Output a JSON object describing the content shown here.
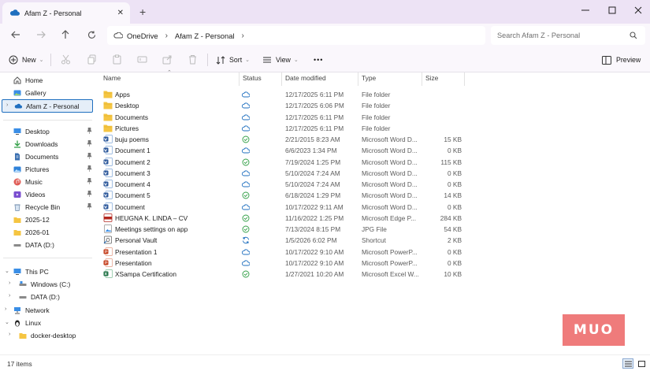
{
  "window": {
    "tab_title": "Afam Z - Personal",
    "new_tab": "+",
    "close_tab": "✕"
  },
  "address": {
    "crumbs": [
      "OneDrive",
      "Afam Z - Personal"
    ],
    "search_placeholder": "Search Afam Z - Personal"
  },
  "toolbar": {
    "new_label": "New",
    "sort_label": "Sort",
    "view_label": "View",
    "more_label": "•••",
    "preview_label": "Preview"
  },
  "sidebar": {
    "top": [
      {
        "label": "Home",
        "icon": "home-icon"
      },
      {
        "label": "Gallery",
        "icon": "gallery-icon"
      },
      {
        "label": "Afam Z - Personal",
        "icon": "onedrive-icon"
      }
    ],
    "quick": [
      {
        "label": "Desktop",
        "icon": "desktop-icon"
      },
      {
        "label": "Downloads",
        "icon": "downloads-icon"
      },
      {
        "label": "Documents",
        "icon": "documents-icon"
      },
      {
        "label": "Pictures",
        "icon": "pictures-icon"
      },
      {
        "label": "Music",
        "icon": "music-icon"
      },
      {
        "label": "Videos",
        "icon": "videos-icon"
      },
      {
        "label": "Recycle Bin",
        "icon": "recycle-bin-icon"
      },
      {
        "label": "2025-12",
        "icon": "folder-icon"
      },
      {
        "label": "2026-01",
        "icon": "folder-icon"
      },
      {
        "label": "DATA (D:)",
        "icon": "drive-icon"
      }
    ],
    "tree": [
      {
        "label": "This PC",
        "icon": "this-pc-icon"
      },
      {
        "label": "Windows (C:)",
        "icon": "drive-c-icon"
      },
      {
        "label": "DATA (D:)",
        "icon": "drive-icon"
      },
      {
        "label": "Network",
        "icon": "network-icon"
      },
      {
        "label": "Linux",
        "icon": "linux-icon"
      },
      {
        "label": "docker-desktop",
        "icon": "folder-icon"
      }
    ]
  },
  "columns": {
    "name": "Name",
    "status": "Status",
    "date": "Date modified",
    "type": "Type",
    "size": "Size"
  },
  "files": [
    {
      "name": "Apps",
      "status": "cloud",
      "date": "12/17/2025 6:11 PM",
      "type": "File folder",
      "size": "",
      "icon": "folder"
    },
    {
      "name": "Desktop",
      "status": "cloud",
      "date": "12/17/2025 6:06 PM",
      "type": "File folder",
      "size": "",
      "icon": "folder"
    },
    {
      "name": "Documents",
      "status": "cloud",
      "date": "12/17/2025 6:11 PM",
      "type": "File folder",
      "size": "",
      "icon": "folder"
    },
    {
      "name": "Pictures",
      "status": "cloud",
      "date": "12/17/2025 6:11 PM",
      "type": "File folder",
      "size": "",
      "icon": "folder"
    },
    {
      "name": "buju poems",
      "status": "synced",
      "date": "2/21/2015 8:23 AM",
      "type": "Microsoft Word D...",
      "size": "15 KB",
      "icon": "word"
    },
    {
      "name": "Document 1",
      "status": "cloud",
      "date": "6/6/2023 1:34 PM",
      "type": "Microsoft Word D...",
      "size": "0 KB",
      "icon": "word"
    },
    {
      "name": "Document 2",
      "status": "synced",
      "date": "7/19/2024 1:25 PM",
      "type": "Microsoft Word D...",
      "size": "115 KB",
      "icon": "word"
    },
    {
      "name": "Document 3",
      "status": "cloud",
      "date": "5/10/2024 7:24 AM",
      "type": "Microsoft Word D...",
      "size": "0 KB",
      "icon": "word"
    },
    {
      "name": "Document 4",
      "status": "cloud",
      "date": "5/10/2024 7:24 AM",
      "type": "Microsoft Word D...",
      "size": "0 KB",
      "icon": "word"
    },
    {
      "name": "Document 5",
      "status": "synced",
      "date": "6/18/2024 1:29 PM",
      "type": "Microsoft Word D...",
      "size": "14 KB",
      "icon": "word"
    },
    {
      "name": "Document",
      "status": "cloud",
      "date": "10/17/2022 9:11 AM",
      "type": "Microsoft Word D...",
      "size": "0 KB",
      "icon": "word"
    },
    {
      "name": "HEUGNA K. LINDA – CV",
      "status": "synced",
      "date": "11/16/2022 1:25 PM",
      "type": "Microsoft Edge P...",
      "size": "284 KB",
      "icon": "pdf"
    },
    {
      "name": "Meetings settings on app",
      "status": "synced",
      "date": "7/13/2024 8:15 PM",
      "type": "JPG File",
      "size": "54 KB",
      "icon": "image"
    },
    {
      "name": "Personal Vault",
      "status": "sync",
      "date": "1/5/2026 6:02 PM",
      "type": "Shortcut",
      "size": "2 KB",
      "icon": "vault"
    },
    {
      "name": "Presentation 1",
      "status": "cloud",
      "date": "10/17/2022 9:10 AM",
      "type": "Microsoft PowerP...",
      "size": "0 KB",
      "icon": "ppt"
    },
    {
      "name": "Presentation",
      "status": "cloud",
      "date": "10/17/2022 9:10 AM",
      "type": "Microsoft PowerP...",
      "size": "0 KB",
      "icon": "ppt"
    },
    {
      "name": "XSampa Certification",
      "status": "synced",
      "date": "1/27/2021 10:20 AM",
      "type": "Microsoft Excel W...",
      "size": "10 KB",
      "icon": "excel"
    }
  ],
  "statusbar": {
    "count": "17 items"
  },
  "watermark": {
    "text": "MUO"
  },
  "colors": {
    "accent": "#1f6fbf",
    "folder": "#f5c542",
    "word": "#2b579a",
    "ppt": "#c43e1c",
    "excel": "#217346",
    "pdf": "#b3261e",
    "synced": "#2f9e44",
    "cloud": "#1f6fbf"
  }
}
